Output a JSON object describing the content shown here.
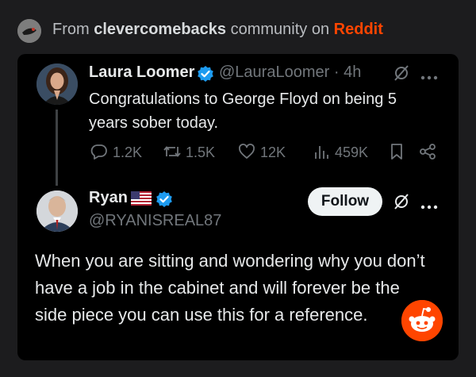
{
  "header": {
    "prefix": "From",
    "community": "clevercomebacks",
    "middle": "community on",
    "platform": "Reddit"
  },
  "tweet1": {
    "name": "Laura Loomer",
    "handle": "@LauraLoomer",
    "separator": "·",
    "time": "4h",
    "text": "Congratulations to George Floyd on being 5 years sober today.",
    "stats": {
      "replies": "1.2K",
      "reposts": "1.5K",
      "likes": "12K",
      "views": "459K"
    }
  },
  "tweet2": {
    "name": "Ryan",
    "flag": "🇺🇸",
    "handle": "@RYANISREAL87",
    "follow_label": "Follow",
    "text": "When you are sitting and wondering why you don’t have a job in the cabinet and will forever be the side piece you can use this for a reference."
  },
  "colors": {
    "accent_blue": "#1d9bf0",
    "reddit_orange": "#ff4500",
    "background": "#000000"
  }
}
